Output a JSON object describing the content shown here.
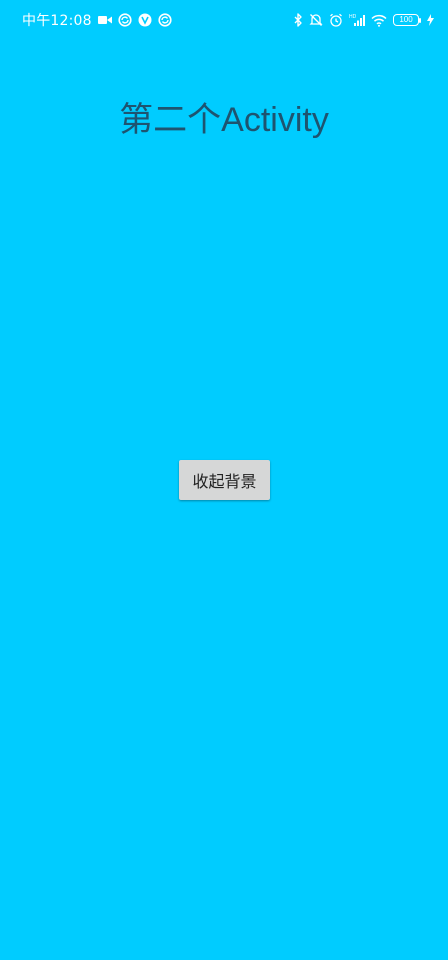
{
  "status_bar": {
    "time": "中午12:08",
    "battery_level": "100",
    "left_icons": [
      "video-camera-icon",
      "sync-icon",
      "vpn-icon",
      "sync-icon"
    ],
    "right_icons": [
      "bluetooth-icon",
      "mute-bell-icon",
      "alarm-icon",
      "signal-icon",
      "wifi-icon",
      "battery-icon",
      "charging-icon"
    ]
  },
  "activity": {
    "title": "第二个Activity"
  },
  "main": {
    "collapse_button_label": "收起背景"
  },
  "colors": {
    "background": "#00CCFF",
    "title_text": "#1e5470",
    "button_background": "#d6d7d7",
    "status_text": "#ffffff"
  }
}
